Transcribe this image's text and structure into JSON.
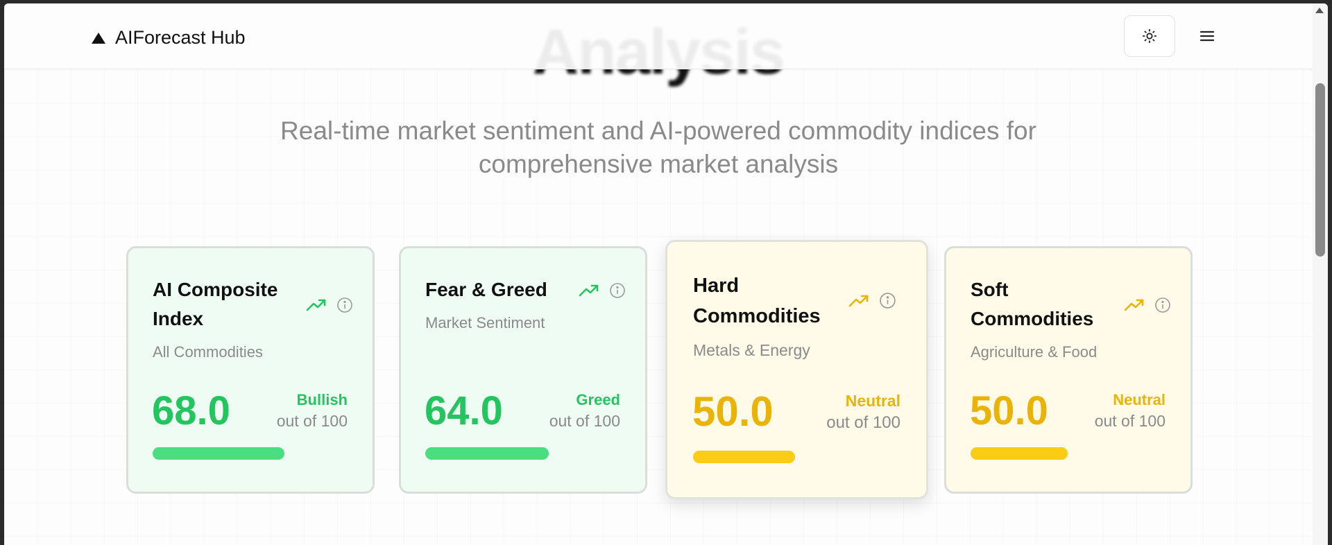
{
  "app": {
    "name": "AIForecast Hub"
  },
  "page": {
    "heading": "Analysis",
    "subtitle_line1": "Real-time market sentiment and AI-powered commodity indices for",
    "subtitle_line2": "comprehensive market analysis"
  },
  "header": {
    "theme_icon": "sun-icon",
    "menu_icon": "menu-icon"
  },
  "cards": [
    {
      "title_line1": "AI Composite",
      "title_line2": "Index",
      "subtitle": "All Commodities",
      "value": "68.0",
      "status": "Bullish",
      "out_of": "out of 100",
      "progress": 0.68,
      "accent": "#22c55e",
      "trend_icon": "trending-up-icon",
      "info_icon": "info-icon"
    },
    {
      "title_line1": "Fear & Greed",
      "title_line2": "",
      "subtitle": "Market Sentiment",
      "value": "64.0",
      "status": "Greed",
      "out_of": "out of 100",
      "progress": 0.64,
      "accent": "#22c55e",
      "trend_icon": "trending-up-icon",
      "info_icon": "info-icon"
    },
    {
      "title_line1": "Hard",
      "title_line2": "Commodities",
      "subtitle": "Metals & Energy",
      "value": "50.0",
      "status": "Neutral",
      "out_of": "out of 100",
      "progress": 0.5,
      "accent": "#eab308",
      "trend_icon": "trending-up-icon",
      "info_icon": "info-icon"
    },
    {
      "title_line1": "Soft",
      "title_line2": "Commodities",
      "subtitle": "Agriculture & Food",
      "value": "50.0",
      "status": "Neutral",
      "out_of": "out of 100",
      "progress": 0.5,
      "accent": "#eab308",
      "trend_icon": "trending-up-icon",
      "info_icon": "info-icon"
    }
  ]
}
